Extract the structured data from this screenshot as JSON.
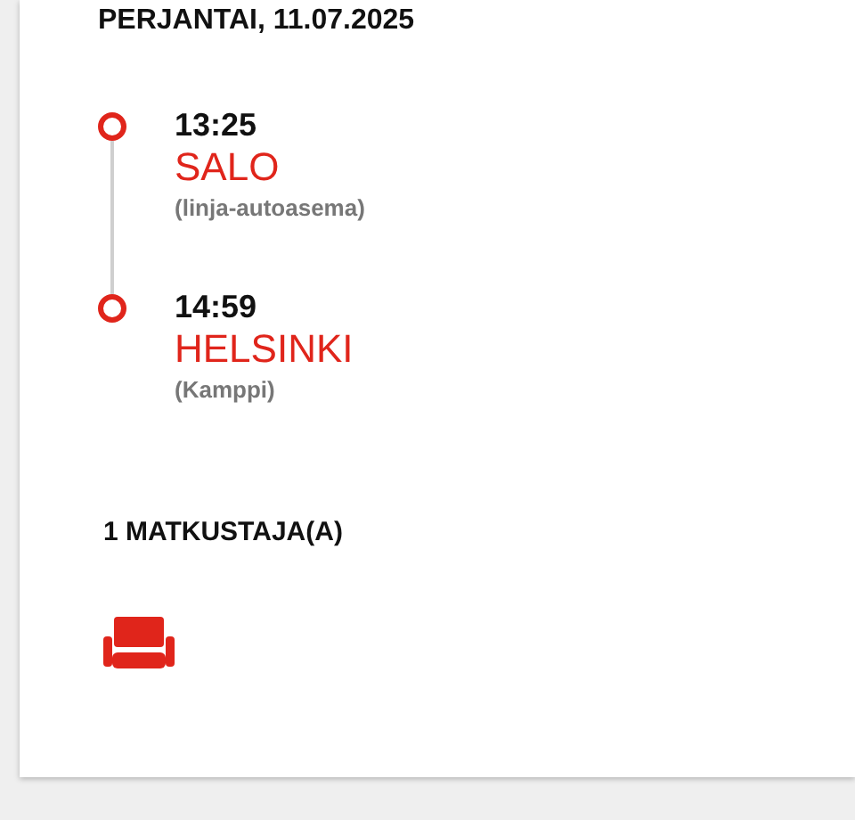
{
  "date": "PERJANTAI, 11.07.2025",
  "stops": [
    {
      "time": "13:25",
      "city": "SALO",
      "place": "(linja-autoasema)"
    },
    {
      "time": "14:59",
      "city": "HELSINKI",
      "place": "(Kamppi)"
    }
  ],
  "passengers": {
    "label": "1 MATKUSTAJA(A)",
    "seats": [
      {
        "kind": "seat"
      }
    ]
  }
}
